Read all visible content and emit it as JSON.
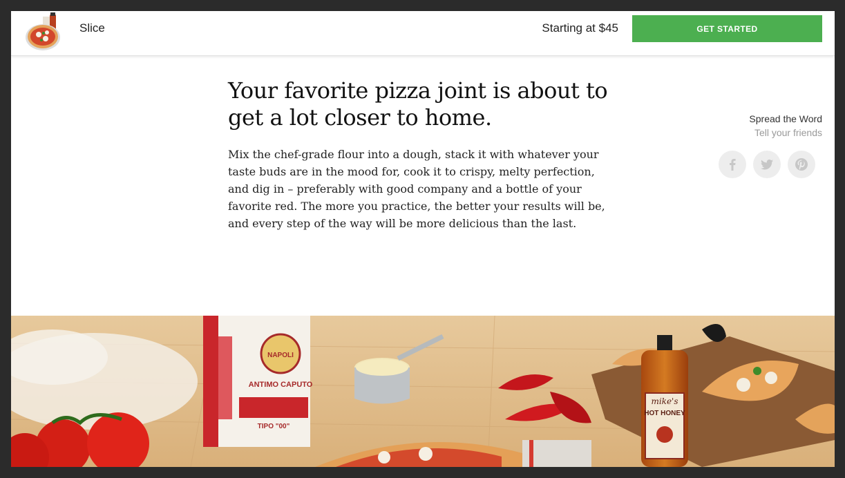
{
  "header": {
    "brand": "Slice",
    "price": "Starting at $45",
    "cta_label": "GET STARTED",
    "logo_icon": "pizza-thumbnail"
  },
  "main": {
    "headline": "Your favorite pizza joint is about to get a lot closer to home.",
    "body": "Mix the chef-grade flour into a dough, stack it with whatever your taste buds are in the mood for, cook it to crispy, melty perfection, and dig in – preferably with good company and a bottle of your favorite red. The more you practice, the better your results will be, and every step of the way will be more delicious than the last."
  },
  "share": {
    "title": "Spread the Word",
    "subtitle": "Tell your friends",
    "icons": [
      "facebook-icon",
      "twitter-icon",
      "pinterest-icon"
    ]
  },
  "hero": {
    "flour_brand": "ANTIMO CAPUTO",
    "flour_maker": "NAPOLI",
    "flour_type": "TIPO \"00\"",
    "honey_brand": "mike's",
    "honey_name": "HOT HONEY"
  },
  "colors": {
    "accent": "#4caf50",
    "frame": "#2b2b2b",
    "share_bg": "#ededed"
  }
}
